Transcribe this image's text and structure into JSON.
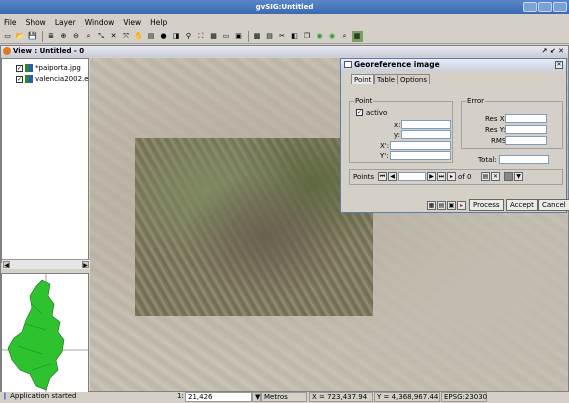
{
  "window": {
    "title": "gvSIG:Untitled"
  },
  "menu": {
    "items": [
      "File",
      "Show",
      "Layer",
      "Window",
      "View",
      "Help"
    ]
  },
  "toolbar": {
    "icons": [
      "new-icon",
      "open-icon",
      "save-icon",
      "layers-icon",
      "zoom-in-icon",
      "zoom-out-icon",
      "zoom-full-icon",
      "zoom-prev-icon",
      "zoom-next-icon",
      "zoom-box-icon",
      "pan-icon",
      "properties-icon",
      "info-icon",
      "select-icon",
      "measure-icon",
      "area-icon",
      "select-rect-icon",
      "graphic-icon",
      "image-icon",
      "table-icon",
      "report-icon",
      "tool-icon",
      "georef-icon",
      "copy-icon",
      "refresh-a-icon",
      "refresh-b-icon",
      "search-icon",
      "georef-active-icon"
    ]
  },
  "view": {
    "title": "View : Untitled - 0",
    "controls": "↗ ↙ ✕"
  },
  "toc": {
    "layers": [
      {
        "name": "*paiporta.jpg",
        "checked": true
      },
      {
        "name": "valencia2002.e",
        "checked": true
      }
    ]
  },
  "georef": {
    "title": "Georeference image",
    "tabs": [
      "Point",
      "Table",
      "Options"
    ],
    "active_tab": "Point",
    "point_group": "Point",
    "activo_label": "activo",
    "activo_checked": true,
    "x_label": "x:",
    "y_label": "y:",
    "X_label": "X':",
    "Y_label": "Y':",
    "error_group": "Error",
    "resx_label": "Res X:",
    "resy_label": "Res Y:",
    "rms_label": "RMS:",
    "total_label": "Total:",
    "points_label": "Points",
    "of_label": "of 0",
    "buttons": {
      "process": "Process",
      "accept": "Accept",
      "cancel": "Cancel"
    }
  },
  "status": {
    "message": "Application started",
    "scale_prefix": "1:",
    "scale": "21,426",
    "units": "Metros",
    "x": "X = 723,437.94",
    "y": "Y = 4,368,967.44",
    "epsg": "EPSG:23030"
  }
}
